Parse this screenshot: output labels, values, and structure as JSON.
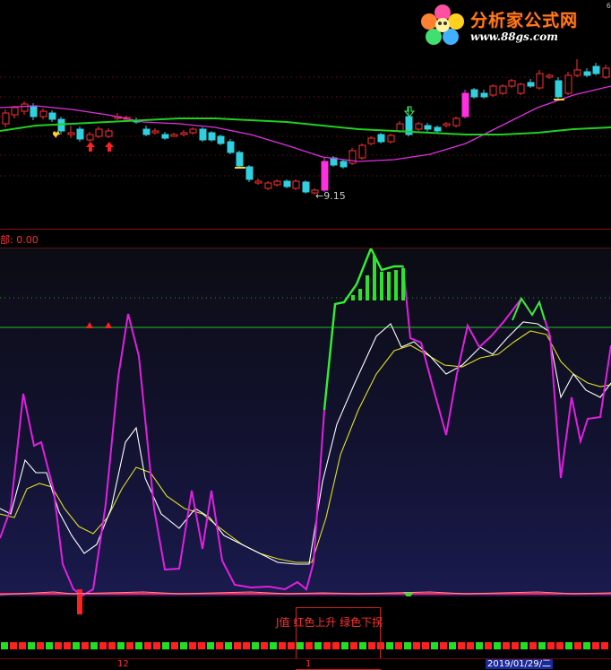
{
  "logo": {
    "title": "分析家公式网",
    "url": "www.88gs.com"
  },
  "corner_number": "6",
  "price_panel": {
    "low_label": "←9.15"
  },
  "separator": {
    "label": "部: 0.00"
  },
  "legend": {
    "text": "J值 红色上升 绿色下拐"
  },
  "axis": {
    "tick_12": "12",
    "tick_1": "1",
    "date": "2019/01/29/二"
  },
  "colors": {
    "up": "#ff3030",
    "down": "#30d0e0",
    "ma_short": "#e030e0",
    "ma_long": "#20d020",
    "k_line": "#ffffff",
    "d_line": "#e0e020",
    "j_line": "#e020e0",
    "ref_line": "#20c020"
  }
}
